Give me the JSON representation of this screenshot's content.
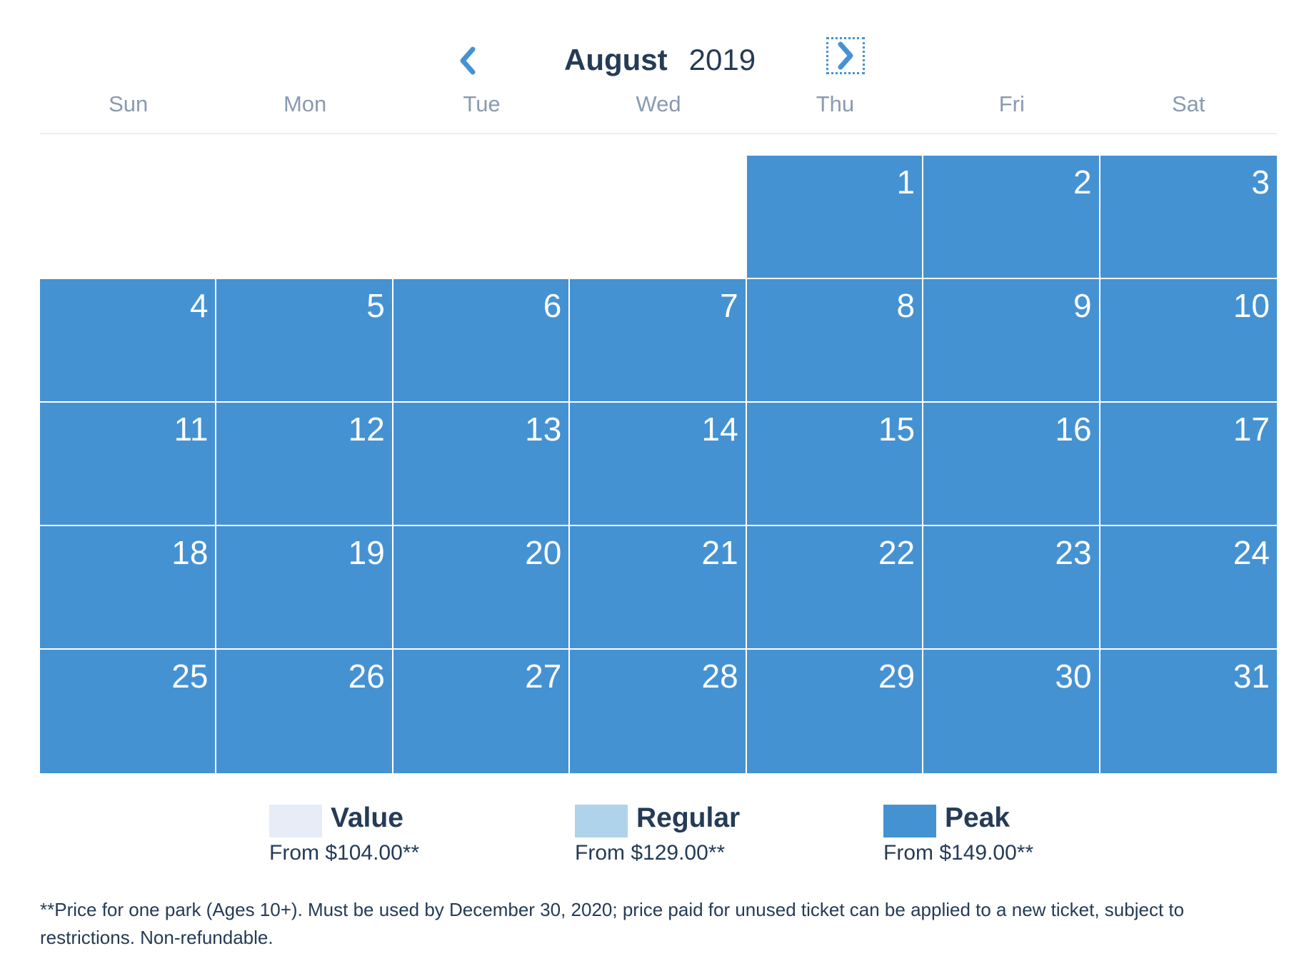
{
  "header": {
    "month": "August",
    "year": "2019",
    "prev_icon": "chevron-left-icon",
    "next_icon": "chevron-right-icon"
  },
  "weekdays": [
    "Sun",
    "Mon",
    "Tue",
    "Wed",
    "Thu",
    "Fri",
    "Sat"
  ],
  "calendar": {
    "first_weekday_index": 4,
    "days_in_month": 31,
    "days": [
      {
        "day": "1",
        "tier": "Peak"
      },
      {
        "day": "2",
        "tier": "Peak"
      },
      {
        "day": "3",
        "tier": "Peak"
      },
      {
        "day": "4",
        "tier": "Peak"
      },
      {
        "day": "5",
        "tier": "Peak"
      },
      {
        "day": "6",
        "tier": "Peak"
      },
      {
        "day": "7",
        "tier": "Peak"
      },
      {
        "day": "8",
        "tier": "Peak"
      },
      {
        "day": "9",
        "tier": "Peak"
      },
      {
        "day": "10",
        "tier": "Peak"
      },
      {
        "day": "11",
        "tier": "Peak"
      },
      {
        "day": "12",
        "tier": "Peak"
      },
      {
        "day": "13",
        "tier": "Peak"
      },
      {
        "day": "14",
        "tier": "Peak"
      },
      {
        "day": "15",
        "tier": "Peak"
      },
      {
        "day": "16",
        "tier": "Peak"
      },
      {
        "day": "17",
        "tier": "Peak"
      },
      {
        "day": "18",
        "tier": "Peak"
      },
      {
        "day": "19",
        "tier": "Peak"
      },
      {
        "day": "20",
        "tier": "Peak"
      },
      {
        "day": "21",
        "tier": "Peak"
      },
      {
        "day": "22",
        "tier": "Peak"
      },
      {
        "day": "23",
        "tier": "Peak"
      },
      {
        "day": "24",
        "tier": "Peak"
      },
      {
        "day": "25",
        "tier": "Peak"
      },
      {
        "day": "26",
        "tier": "Peak"
      },
      {
        "day": "27",
        "tier": "Peak"
      },
      {
        "day": "28",
        "tier": "Peak"
      },
      {
        "day": "29",
        "tier": "Peak"
      },
      {
        "day": "30",
        "tier": "Peak"
      },
      {
        "day": "31",
        "tier": "Peak"
      }
    ]
  },
  "legend": [
    {
      "label": "Value",
      "price": "From $104.00**",
      "color": "#e6edf6"
    },
    {
      "label": "Regular",
      "price": "From $129.00**",
      "color": "#b0d3ec"
    },
    {
      "label": "Peak",
      "price": "From $149.00**",
      "color": "#4592d3"
    }
  ],
  "footer": {
    "note": "**Price for one park (Ages 10+). Must be used by December 30, 2020; price paid for unused ticket can be applied to a new ticket, subject to restrictions. Non-refundable."
  }
}
